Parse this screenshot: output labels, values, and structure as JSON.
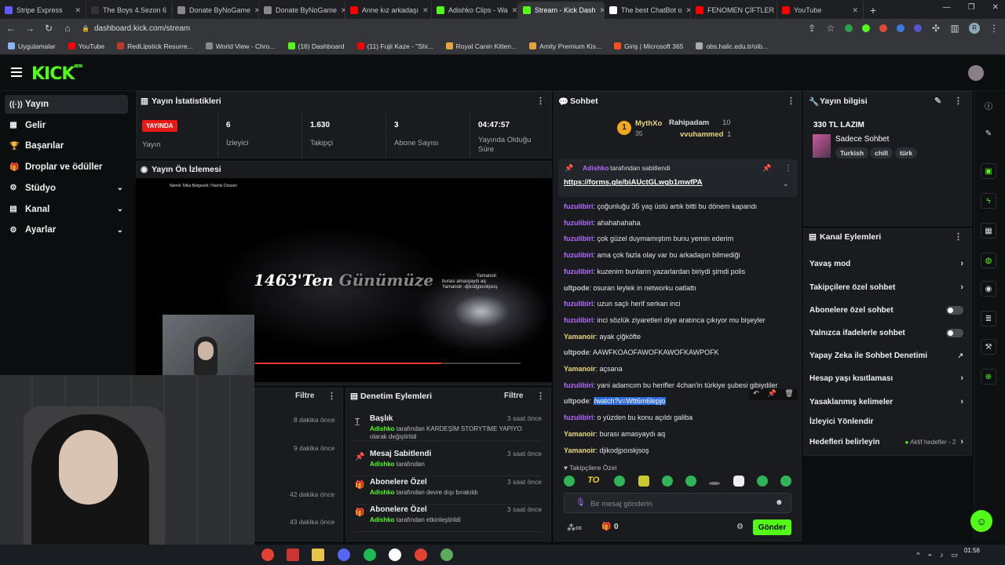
{
  "browser": {
    "tabs": [
      {
        "title": "Stripe Express",
        "color": "#635bff",
        "active": false
      },
      {
        "title": "The Boys 4.Sezon 6",
        "color": "#333333",
        "active": false
      },
      {
        "title": "Donate ByNoGame",
        "color": "#888888",
        "active": false
      },
      {
        "title": "Donate ByNoGame",
        "color": "#888888",
        "active": false
      },
      {
        "title": "Anne kız arkadaşı",
        "color": "#ff0000",
        "active": false
      },
      {
        "title": "Adishko Clips - Wa",
        "color": "#53fc18",
        "active": false
      },
      {
        "title": "Stream - Kick Dash",
        "color": "#53fc18",
        "active": true
      },
      {
        "title": "The best ChatBot o",
        "color": "#ffffff",
        "active": false
      },
      {
        "title": "FENOMEN ÇİFTLER",
        "color": "#ff0000",
        "active": false
      },
      {
        "title": "YouTube",
        "color": "#ff0000",
        "active": false
      }
    ],
    "url": "dashboard.kick.com/stream",
    "bookmarks": [
      "Uygulamalar",
      "YouTube",
      "RedLipstick Resurre...",
      "World View - Chro...",
      "(16) Dashboard",
      "(11) Fujii Kaze - \"Shi...",
      "Royal Canin Kitten...",
      "Amity Premium Kis...",
      "Giriş | Microsoft 365",
      "obs.halic.edu.tr/oib..."
    ],
    "profile_initial": "R"
  },
  "app": {
    "logo": "KICK",
    "logo_badge": "BETA"
  },
  "sidebar": {
    "items": [
      {
        "label": "Yayın",
        "icon": "broadcast-icon",
        "active": true,
        "chevron": false
      },
      {
        "label": "Gelir",
        "icon": "revenue-icon",
        "active": false,
        "chevron": false
      },
      {
        "label": "Başarılar",
        "icon": "trophy-icon",
        "active": false,
        "chevron": false
      },
      {
        "label": "Droplar ve ödüller",
        "icon": "gift-icon",
        "active": false,
        "chevron": false
      },
      {
        "label": "Stüdyo",
        "icon": "studio-icon",
        "active": false,
        "chevron": true
      },
      {
        "label": "Kanal",
        "icon": "channel-icon",
        "active": false,
        "chevron": true
      },
      {
        "label": "Ayarlar",
        "icon": "gear-icon",
        "active": false,
        "chevron": true
      }
    ]
  },
  "stats": {
    "title": "Yayın İstatistikleri",
    "live_badge": "YAYINDA",
    "live_label": "Yayın",
    "items": [
      {
        "value": "6",
        "label": "İzleyici"
      },
      {
        "value": "1.630",
        "label": "Takipçi"
      },
      {
        "value": "3",
        "label": "Abone Sayısı"
      },
      {
        "value": "04:47:57",
        "label": "Yayında Olduğu Süre"
      }
    ]
  },
  "preview": {
    "title": "Yayın Ön İzlemesi",
    "overlay_top": "Namık Tolka Belgeseli / Namık Dosseri",
    "main_text_a": "1463'Ten",
    "main_text_b": "Günümüze",
    "chat_overlay": [
      "Yamanoir:",
      "burası amasyaydı aq",
      "Yamanoir: djikodjpoıskjsoş"
    ]
  },
  "log": {
    "filter": "Filtre",
    "times": [
      "8 dakika önce",
      "9 dakika önce",
      "42 dakika önce",
      "43 dakika önce"
    ]
  },
  "mod_actions": {
    "title": "Denetim Eylemleri",
    "filter": "Filtre",
    "items": [
      {
        "icon": "title-icon",
        "title": "Başlık",
        "user": "Adishko",
        "text": "tarafından KARDEŞİM STORYTIME YAPIYO olarak değiştirildi",
        "time": "3 saat önce"
      },
      {
        "icon": "pin-icon",
        "title": "Mesaj Sabitlendi",
        "user": "Adishko",
        "text": "tarafından",
        "time": "3 saat önce"
      },
      {
        "icon": "gift-icon",
        "title": "Abonelere Özel",
        "user": "Adishko",
        "text": "tarafından devre dışı bırakıldı",
        "time": "3 saat önce"
      },
      {
        "icon": "gift-icon",
        "title": "Abonelere Özel",
        "user": "Adishko",
        "text": "tarafından etkinleştirildi",
        "time": "3 saat önce"
      }
    ]
  },
  "chat": {
    "title": "Sohbet",
    "top": [
      {
        "name": "MythXo",
        "count": "35"
      },
      {
        "name": "Rahipadam",
        "count": "10"
      },
      {
        "name": "vvuhammed",
        "count": "1"
      }
    ],
    "pinned_by_user": "Adishko",
    "pinned_by_text": "tarafından sabitlendi",
    "pinned_link": "https://forms.gle/biAUctGLwgb1mwfPA",
    "messages": [
      {
        "user": "fuzulibiri",
        "text": "çoğunluğu 35 yaş üstü artık bitti bu dönem kapandı",
        "color": "u-p"
      },
      {
        "user": "fuzulibiri",
        "text": "ahahahahaha",
        "color": "u-p"
      },
      {
        "user": "fuzulibiri",
        "text": "çok güzel duymamıştım bunu yemin ederim",
        "color": "u-p"
      },
      {
        "user": "fuzulibiri",
        "text": "ama çok fazla olay var bu arkadaşın bilmediği",
        "color": "u-p"
      },
      {
        "user": "fuzulibiri",
        "text": "kuzenim bunların yazarlardan biriydi şimdi polis",
        "color": "u-p"
      },
      {
        "user": "ultpode",
        "text": "osuran leylek in networku oatlattı",
        "color": "u-g"
      },
      {
        "user": "fuzulibiri",
        "text": "uzun saçlı herif serkan inci",
        "color": "u-p"
      },
      {
        "user": "fuzulibiri",
        "text": "inci sözlük ziyaretleri diye aratınca çıkıyor mu bişeyler",
        "color": "u-p"
      },
      {
        "user": "Yamanoir",
        "text": "ayak çiğköfte",
        "color": "u-y"
      },
      {
        "user": "ultpode",
        "text": "AAWFKOAOFAWOFKAWOFKAWPOFK",
        "color": "u-g"
      },
      {
        "user": "Yamanoir",
        "text": "açsana",
        "color": "u-y"
      },
      {
        "user": "fuzulibiri",
        "text": "yani adamcım bu herifler 4chan'in türkiye şubesi gibiydiler",
        "color": "u-p"
      },
      {
        "user": "ultpode",
        "text": "/watch?v=Wtt6m6lepjo",
        "color": "u-g",
        "highlight": true
      },
      {
        "user": "fuzulibiri",
        "text": "o yüzden bu konu açıldı galiba",
        "color": "u-p"
      },
      {
        "user": "Yamanoir",
        "text": "burası amasyaydı aq",
        "color": "u-y"
      },
      {
        "user": "Yamanoir",
        "text": "djikodjpoıskjsoş",
        "color": "u-y"
      }
    ],
    "followers_only": "Takipçilere Özel",
    "input_placeholder": "Bir mesaj gönderin",
    "points_count": "0",
    "send_label": "Gönder"
  },
  "stream_info": {
    "title": "Yayın bilgisi",
    "stream_title": "330 TL LAZIM",
    "category": "Sadece Sohbet",
    "tags": [
      "Turkish",
      "chill",
      "türk"
    ]
  },
  "channel_actions": {
    "title": "Kanal Eylemleri",
    "items": [
      {
        "label": "Yavaş mod",
        "control": "chevron"
      },
      {
        "label": "Takipçilere özel sohbet",
        "control": "chevron"
      },
      {
        "label": "Abonelere özel sohbet",
        "control": "toggle"
      },
      {
        "label": "Yalnızca ifadelerle sohbet",
        "control": "toggle"
      },
      {
        "label": "Yapay Zeka ile Sohbet Denetimi",
        "control": "external"
      },
      {
        "label": "Hesap yaşı kısıtlaması",
        "control": "chevron"
      },
      {
        "label": "Yasaklanmış kelimeler",
        "control": "chevron"
      },
      {
        "label": "İzleyici Yönlendir",
        "control": "none"
      },
      {
        "label": "Hedefleri belirleyin",
        "control": "goal"
      }
    ],
    "goal_text": "Aktif hedefler - 2"
  },
  "clock": {
    "time": "01:56"
  }
}
